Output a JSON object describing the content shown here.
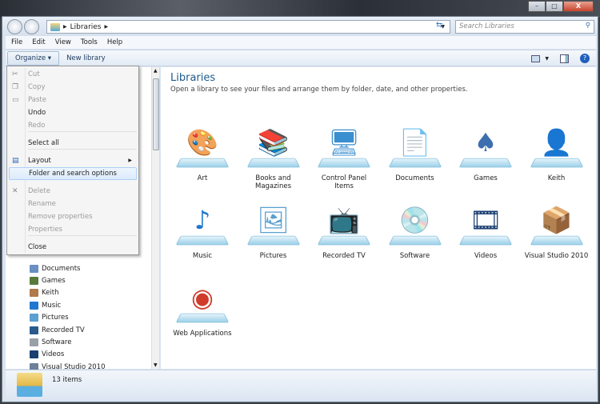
{
  "window": {
    "minimize": "–",
    "maximize": "□",
    "close": "X"
  },
  "address": {
    "crumbs": [
      "Libraries"
    ],
    "search_placeholder": "Search Libraries"
  },
  "menubar": [
    "File",
    "Edit",
    "View",
    "Tools",
    "Help"
  ],
  "toolbar": {
    "organize": "Organize ▾",
    "new_library": "New library"
  },
  "organize_menu": [
    {
      "label": "Cut",
      "disabled": true,
      "icon": "scissors-icon"
    },
    {
      "label": "Copy",
      "disabled": true,
      "icon": "copy-icon"
    },
    {
      "label": "Paste",
      "disabled": true,
      "icon": "paste-icon"
    },
    {
      "label": "Undo",
      "disabled": false
    },
    {
      "label": "Redo",
      "disabled": true
    },
    {
      "label": "Select all",
      "disabled": false
    },
    {
      "label": "Layout",
      "disabled": false,
      "submenu": true,
      "icon": "layout-icon"
    },
    {
      "label": "Folder and search options",
      "disabled": false,
      "highlighted": true
    },
    {
      "label": "Delete",
      "disabled": true,
      "icon": "delete-icon"
    },
    {
      "label": "Rename",
      "disabled": true
    },
    {
      "label": "Remove properties",
      "disabled": true
    },
    {
      "label": "Properties",
      "disabled": true
    },
    {
      "label": "Close",
      "disabled": false
    }
  ],
  "nav": [
    "Documents",
    "Games",
    "Keith",
    "Music",
    "Pictures",
    "Recorded TV",
    "Software",
    "Videos",
    "Visual Studio 2010"
  ],
  "main": {
    "title": "Libraries",
    "subtitle": "Open a library to see your files and arrange them by folder, date, and other properties.",
    "libraries": [
      {
        "name": "Art",
        "color": "#c9a05a",
        "glyph": "🎨"
      },
      {
        "name": "Books and Magazines",
        "color": "#b03030",
        "glyph": "📚"
      },
      {
        "name": "Control Panel Items",
        "color": "#3a8fd0",
        "glyph": "🖥"
      },
      {
        "name": "Documents",
        "color": "#e8e8e8",
        "glyph": "📄"
      },
      {
        "name": "Games",
        "color": "#3d6fb0",
        "glyph": "♠"
      },
      {
        "name": "Keith",
        "color": "#3a8a3a",
        "glyph": "👤"
      },
      {
        "name": "Music",
        "color": "#1f77d0",
        "glyph": "♪"
      },
      {
        "name": "Pictures",
        "color": "#5aa0d0",
        "glyph": "🖼"
      },
      {
        "name": "Recorded TV",
        "color": "#2a5b8c",
        "glyph": "📺"
      },
      {
        "name": "Software",
        "color": "#9aa0a8",
        "glyph": "💿"
      },
      {
        "name": "Videos",
        "color": "#1a3f70",
        "glyph": "🎞"
      },
      {
        "name": "Visual Studio 2010",
        "color": "#6d7f99",
        "glyph": "📦"
      },
      {
        "name": "Web Applications",
        "color": "#d03c2c",
        "glyph": "◉"
      }
    ]
  },
  "status": {
    "count": "13 items"
  }
}
